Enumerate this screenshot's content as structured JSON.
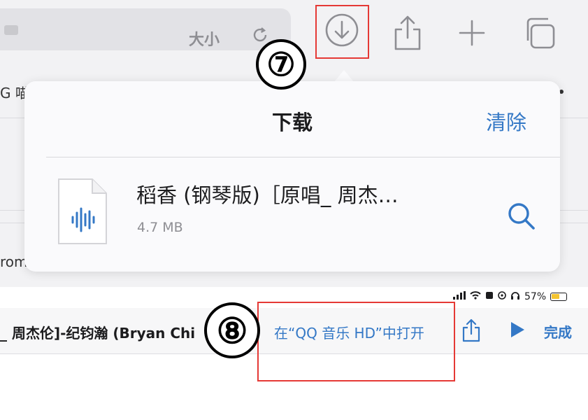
{
  "browser": {
    "text_size_label": "大小"
  },
  "background": {
    "left_text": "G 喵",
    "left_text_lower": "rom"
  },
  "downloads": {
    "title": "下载",
    "clear_label": "清除",
    "file": {
      "name": "稻香 (钢琴版)［原唱_ 周杰…",
      "size": "4.7 MB"
    }
  },
  "steps": {
    "step7": "⑦",
    "step8": "⑧"
  },
  "status_bar": {
    "battery": "57%",
    "battery_level": 0.57
  },
  "bottom_bar": {
    "track_title": "_ 周杰伦]-纪钧瀚 (Bryan Chi",
    "open_in": "在“QQ 音乐 HD”中打开",
    "done_label": "完成"
  },
  "colors": {
    "accent": "#3478c6",
    "highlight": "#e53935",
    "battery": "#f4c430"
  },
  "icons": [
    "reload-icon",
    "download-icon",
    "share-icon",
    "new-tab-icon",
    "tabs-icon",
    "audio-file-icon",
    "search-icon",
    "play-icon",
    "signal-icon",
    "wifi-icon",
    "headphones-icon",
    "battery-icon"
  ]
}
